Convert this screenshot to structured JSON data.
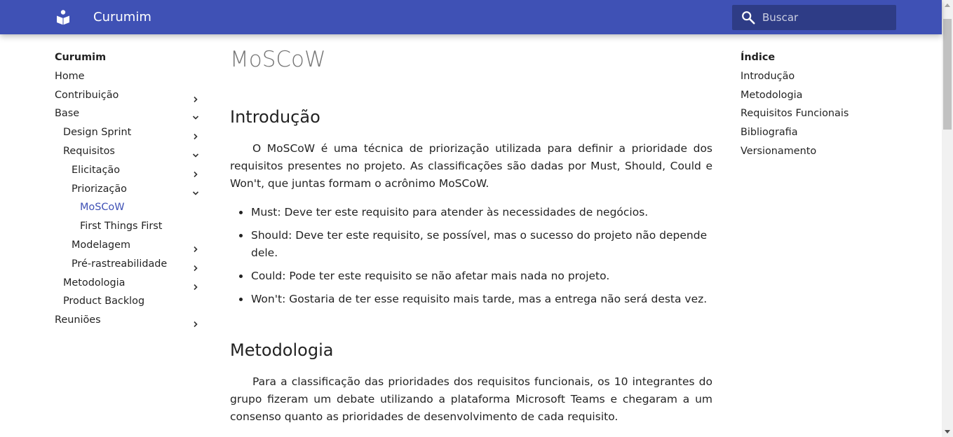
{
  "header": {
    "site_title": "Curumim",
    "search_placeholder": "Buscar"
  },
  "nav": {
    "title": "Curumim",
    "items": [
      {
        "label": "Home",
        "level": 1,
        "chevron": "none"
      },
      {
        "label": "Contribuição",
        "level": 1,
        "chevron": "right"
      },
      {
        "label": "Base",
        "level": 1,
        "chevron": "down"
      },
      {
        "label": "Design Sprint",
        "level": 2,
        "chevron": "right"
      },
      {
        "label": "Requisitos",
        "level": 2,
        "chevron": "down"
      },
      {
        "label": "Elicitação",
        "level": 3,
        "chevron": "right"
      },
      {
        "label": "Priorização",
        "level": 3,
        "chevron": "down"
      },
      {
        "label": "MoSCoW",
        "level": 4,
        "chevron": "none",
        "active": true
      },
      {
        "label": "First Things First",
        "level": 4,
        "chevron": "none"
      },
      {
        "label": "Modelagem",
        "level": 3,
        "chevron": "right"
      },
      {
        "label": "Pré-rastreabilidade",
        "level": 3,
        "chevron": "right"
      },
      {
        "label": "Metodologia",
        "level": 2,
        "chevron": "right"
      },
      {
        "label": "Product Backlog",
        "level": 2,
        "chevron": "none"
      },
      {
        "label": "Reuniões",
        "level": 1,
        "chevron": "right"
      }
    ]
  },
  "content": {
    "title": "MoSCoW",
    "intro_heading": "Introdução",
    "intro_paragraph": "O MoSCoW é uma técnica de priorização utilizada para definir a prioridade dos requisitos presentes no projeto. As classificações são dadas por Must, Should, Could e Won't, que juntas formam o acrônimo MoSCoW.",
    "bullets": [
      "Must: Deve ter este requisito para atender às necessidades de negócios.",
      "Should: Deve ter este requisito, se possível, mas o sucesso do projeto não depende dele.",
      "Could: Pode ter este requisito se não afetar mais nada no projeto.",
      "Won't: Gostaria de ter esse requisito mais tarde, mas a entrega não será desta vez."
    ],
    "method_heading": "Metodologia",
    "method_paragraph": "Para a classificação das prioridades dos requisitos funcionais, os 10 integrantes do grupo fizeram um debate utilizando a plataforma Microsoft Teams e chegaram a um consenso quanto as prioridades de desenvolvimento de cada requisito."
  },
  "toc": {
    "title": "Índice",
    "items": [
      "Introdução",
      "Metodologia",
      "Requisitos Funcionais",
      "Bibliografia",
      "Versionamento"
    ]
  },
  "colors": {
    "primary": "#3f51b5",
    "active_link": "#3f51b5"
  },
  "icons": {
    "logo": "book-reader-icon",
    "search": "search-icon",
    "chevron_right": "chevron-right-icon",
    "chevron_down": "chevron-down-icon"
  }
}
